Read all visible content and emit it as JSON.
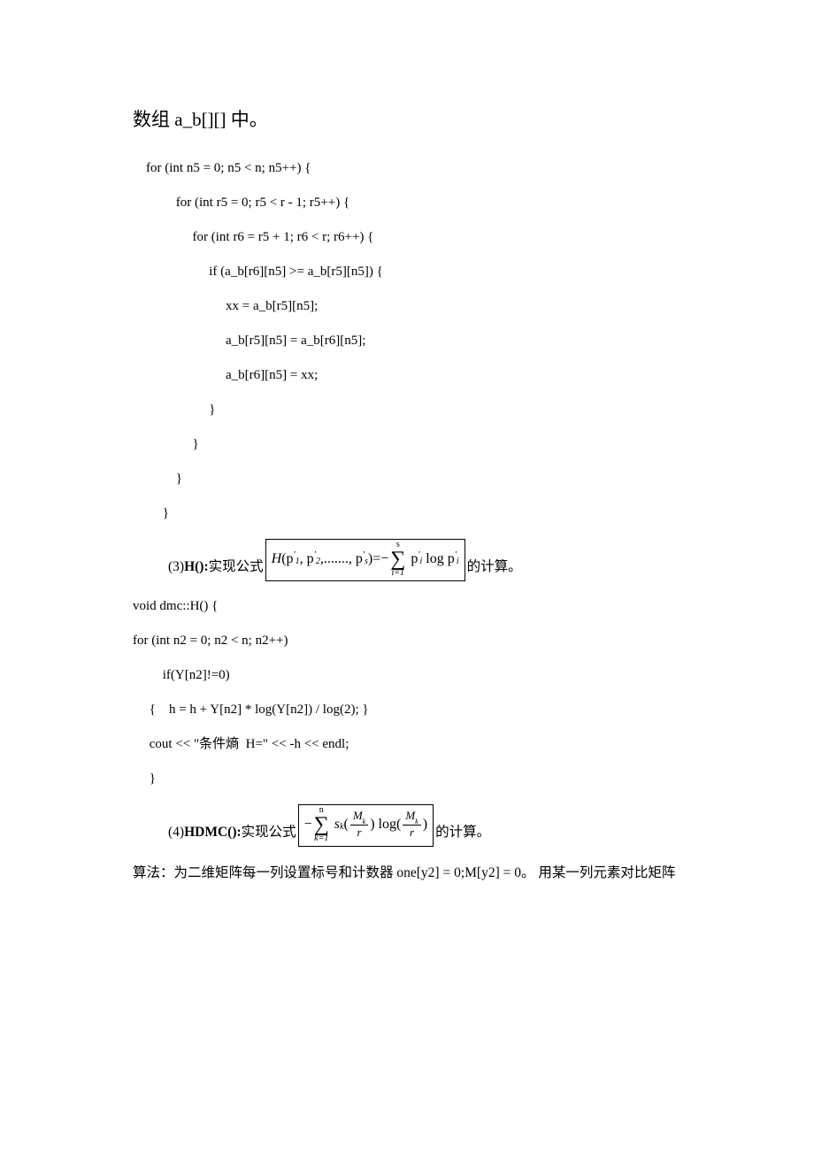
{
  "intro": "数组 a_b[][] 中。",
  "code1": {
    "l1": "    for (int n5 = 0; n5 < n; n5++) {",
    "l2": "             for (int r5 = 0; r5 < r - 1; r5++) {",
    "l3": "                  for (int r6 = r5 + 1; r6 < r; r6++) {",
    "l4": "                       if (a_b[r6][n5] >= a_b[r5][n5]) {",
    "l5": "                            xx = a_b[r5][n5];",
    "l6": "                            a_b[r5][n5] = a_b[r6][n5];",
    "l7": "                            a_b[r6][n5] = xx;",
    "l8": "                       }",
    "l9": "                  }",
    "l10": "             }",
    "l11": "         }"
  },
  "sec3": {
    "prefix_num": "(3)",
    "prefix_bold": "H():",
    "prefix_tail": "实现公式",
    "suffix": "的计算。",
    "formula": {
      "H": "H",
      "open": "(",
      "p": "p",
      "comma": ",",
      "dots": ".......,",
      "close": ")",
      "eq": " = ",
      "neg": "−",
      "log": "log",
      "sum_top": "s",
      "sum_bot": "i=1",
      "sub1": "1",
      "sub2": "2",
      "subs": "s",
      "subi": "i",
      "tick": "'"
    }
  },
  "code2": {
    "l1": "void dmc::H() {",
    "l2": "for (int n2 = 0; n2 < n; n2++)",
    "l3": "         if(Y[n2]!=0)",
    "l4": "     {    h = h + Y[n2] * log(Y[n2]) / log(2); }",
    "l5": "     cout << \"条件熵  H=\" << -h << endl;",
    "l6": "     }"
  },
  "sec4": {
    "prefix_num": "(4)",
    "prefix_bold": "HDMC():",
    "prefix_tail": "实现公式",
    "suffix": "的计算。",
    "formula": {
      "neg": "−",
      "sum_top": "n",
      "sum_bot": "k=1",
      "S": "s",
      "subk": "k",
      "open": "(",
      "close": ")",
      "log": "log",
      "Mnum": "M",
      "Mnumsub": "k",
      "r": "r"
    }
  },
  "algo": "算法：为二维矩阵每一列设置标号和计数器 one[y2] = 0;M[y2] = 0。 用某一列元素对比矩阵"
}
